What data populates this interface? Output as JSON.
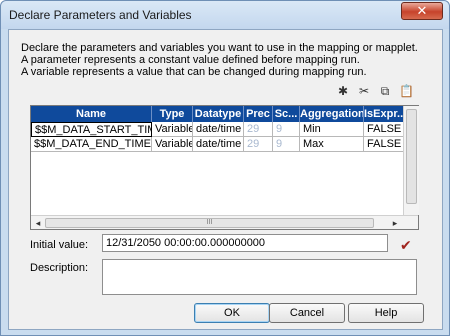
{
  "window": {
    "title": "Declare Parameters and Variables",
    "close_glyph": "✕"
  },
  "description_lines": [
    "Declare the parameters and variables you want to use in the mapping or mapplet.",
    "A parameter represents a constant value defined before mapping run.",
    "A variable represents a value that can be changed during mapping run."
  ],
  "toolbar": {
    "icons": [
      "new-icon",
      "cut-icon",
      "copy-icon",
      "paste-icon"
    ],
    "glyphs": [
      "✱",
      "✂",
      "⧉",
      "📋"
    ]
  },
  "grid": {
    "columns": [
      "Name",
      "Type",
      "Datatype",
      "Prec",
      "Sc...",
      "Aggregation",
      "IsExpr..."
    ],
    "rows": [
      [
        "$$M_DATA_START_TIME",
        "Variable",
        "date/time",
        "29",
        "9",
        "Min",
        "FALSE"
      ],
      [
        "$$M_DATA_END_TIME",
        "Variable",
        "date/time",
        "29",
        "9",
        "Max",
        "FALSE"
      ]
    ],
    "hscroll_grip": "III",
    "left_arrow": "◂",
    "right_arrow": "▸"
  },
  "fields": {
    "initial_value_label": "Initial value:",
    "initial_value": "12/31/2050 00:00:00.000000000",
    "description_label": "Description:",
    "description_value": ""
  },
  "validate_glyph": "✔",
  "buttons": {
    "ok": "OK",
    "cancel": "Cancel",
    "help": "Help"
  }
}
